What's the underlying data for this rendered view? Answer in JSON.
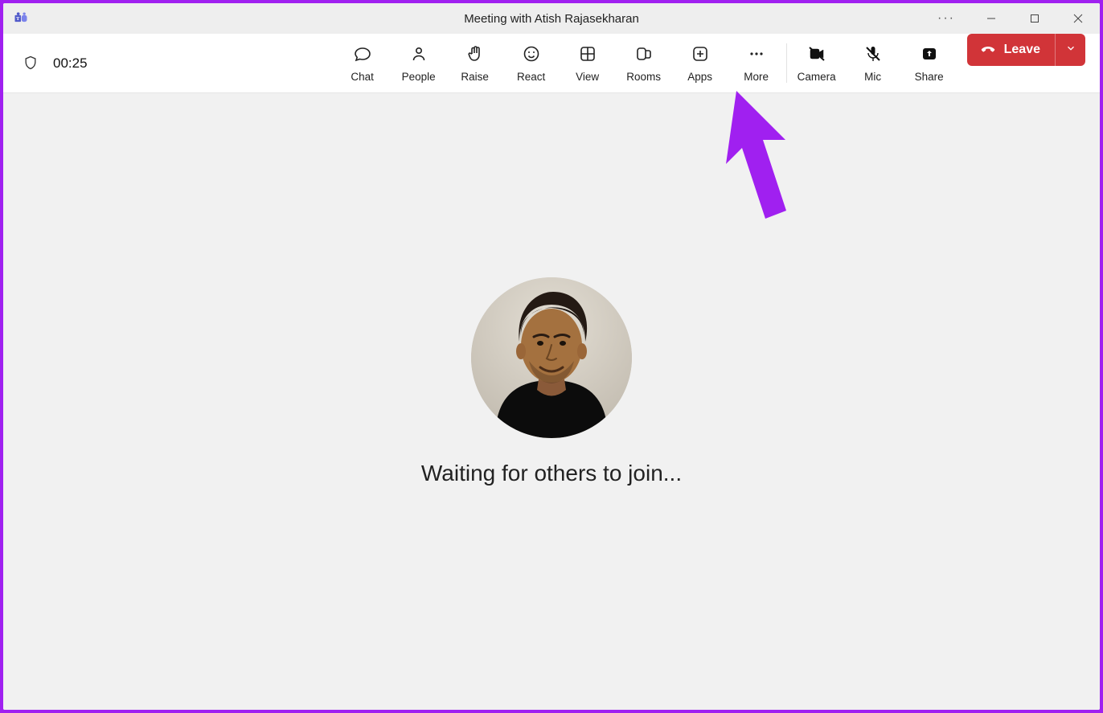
{
  "window": {
    "title": "Meeting with Atish Rajasekharan"
  },
  "toolbar": {
    "timer": "00:25",
    "actions": {
      "chat": "Chat",
      "people": "People",
      "raise": "Raise",
      "react": "React",
      "view": "View",
      "rooms": "Rooms",
      "apps": "Apps",
      "more": "More",
      "camera": "Camera",
      "mic": "Mic",
      "share": "Share"
    },
    "leave_label": "Leave"
  },
  "main": {
    "waiting_text": "Waiting for others to join..."
  },
  "colors": {
    "leave_button": "#d13438",
    "annotation": "#a020f0"
  }
}
